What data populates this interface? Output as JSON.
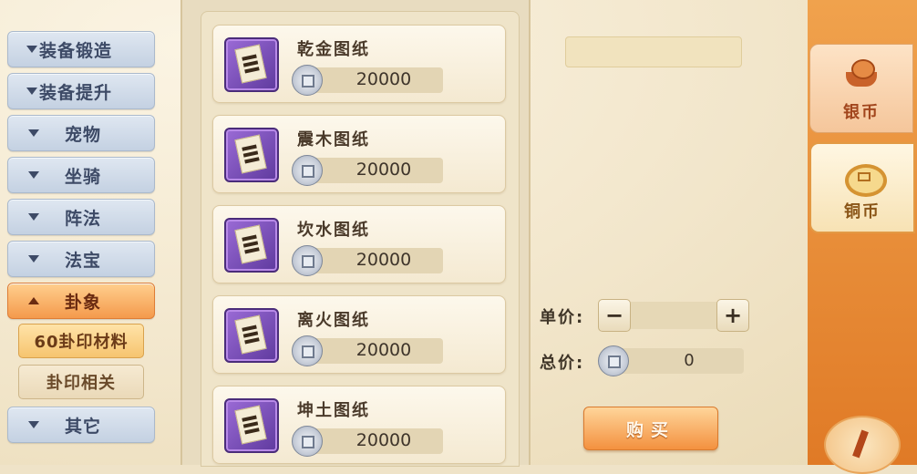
{
  "menu": {
    "categories": [
      {
        "label": "装备锻造"
      },
      {
        "label": "装备提升"
      },
      {
        "label": "宠物"
      },
      {
        "label": "坐骑"
      },
      {
        "label": "阵法"
      },
      {
        "label": "法宝"
      },
      {
        "label": "卦象"
      },
      {
        "label": "其它"
      }
    ],
    "active_category": "卦象",
    "subcategories": [
      {
        "label": "60卦印材料",
        "selected": true
      },
      {
        "label": "卦印相关",
        "selected": false
      }
    ]
  },
  "items": [
    {
      "name": "乾金图纸",
      "price": "20000",
      "icon": "scroll-icon"
    },
    {
      "name": "震木图纸",
      "price": "20000",
      "icon": "scroll-icon"
    },
    {
      "name": "坎水图纸",
      "price": "20000",
      "icon": "scroll-icon"
    },
    {
      "name": "离火图纸",
      "price": "20000",
      "icon": "scroll-icon"
    },
    {
      "name": "坤土图纸",
      "price": "20000",
      "icon": "scroll-icon"
    }
  ],
  "detail": {
    "unit_price_label": "单价:",
    "total_price_label": "总价:",
    "total_value": "0",
    "minus_label": "−",
    "plus_label": "+",
    "buy_label": "购买"
  },
  "currency_tabs": [
    {
      "label": "银币",
      "icon": "silver-ingot-icon",
      "selected": false
    },
    {
      "label": "铜币",
      "icon": "copper-coin-icon",
      "selected": true
    }
  ],
  "colors": {
    "accent": "#f49a4c",
    "menu_inactive": "#c4d1e2",
    "panel": "#efe4c9"
  }
}
